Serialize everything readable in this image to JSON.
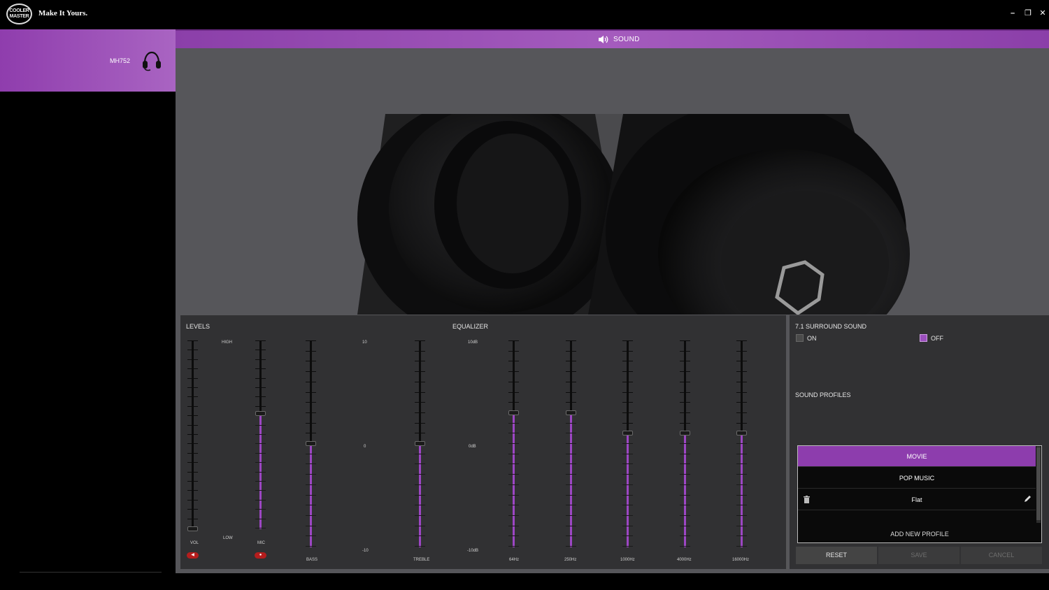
{
  "app": {
    "tagline": "Make It Yours.",
    "logo_line1": "COOLER",
    "logo_line2": "MASTER"
  },
  "window": {
    "minimize": "–",
    "restore": "❐",
    "close": "✕"
  },
  "device": {
    "name": "MH752"
  },
  "section": {
    "title": "SOUND"
  },
  "levels": {
    "title": "LEVELS",
    "high": "HIGH",
    "low": "LOW",
    "vol_label": "VOL",
    "mic_label": "MIC",
    "vol_level": 0.0,
    "mic_level": 0.61
  },
  "equalizer": {
    "title": "EQUALIZER",
    "bass_treble_scale": {
      "top": "10",
      "mid": "0",
      "bottom": "-10"
    },
    "band_scale": {
      "top": "10dB",
      "mid": "0dB",
      "bottom": "-10dB"
    },
    "bass": {
      "label": "BASS",
      "level": 0.5
    },
    "treble": {
      "label": "TREBLE",
      "level": 0.5
    },
    "bands": [
      {
        "label": "64Hz",
        "level": 0.65
      },
      {
        "label": "250Hz",
        "level": 0.65
      },
      {
        "label": "1000Hz",
        "level": 0.55
      },
      {
        "label": "4000Hz",
        "level": 0.55
      },
      {
        "label": "16000Hz",
        "level": 0.55
      }
    ]
  },
  "surround": {
    "title": "7.1 SURROUND SOUND",
    "on_label": "ON",
    "off_label": "OFF",
    "selected": "OFF"
  },
  "profiles": {
    "title": "SOUND PROFILES",
    "items": [
      "MOVIE",
      "POP MUSIC",
      "Flat"
    ],
    "selected": "MOVIE",
    "add_label": "ADD NEW PROFILE"
  },
  "actions": {
    "reset": "RESET",
    "save": "SAVE",
    "cancel": "CANCEL"
  },
  "colors": {
    "accent": "#9c46c3",
    "mute": "#b41d1d",
    "panel": "#313133",
    "background": "#56565a"
  }
}
